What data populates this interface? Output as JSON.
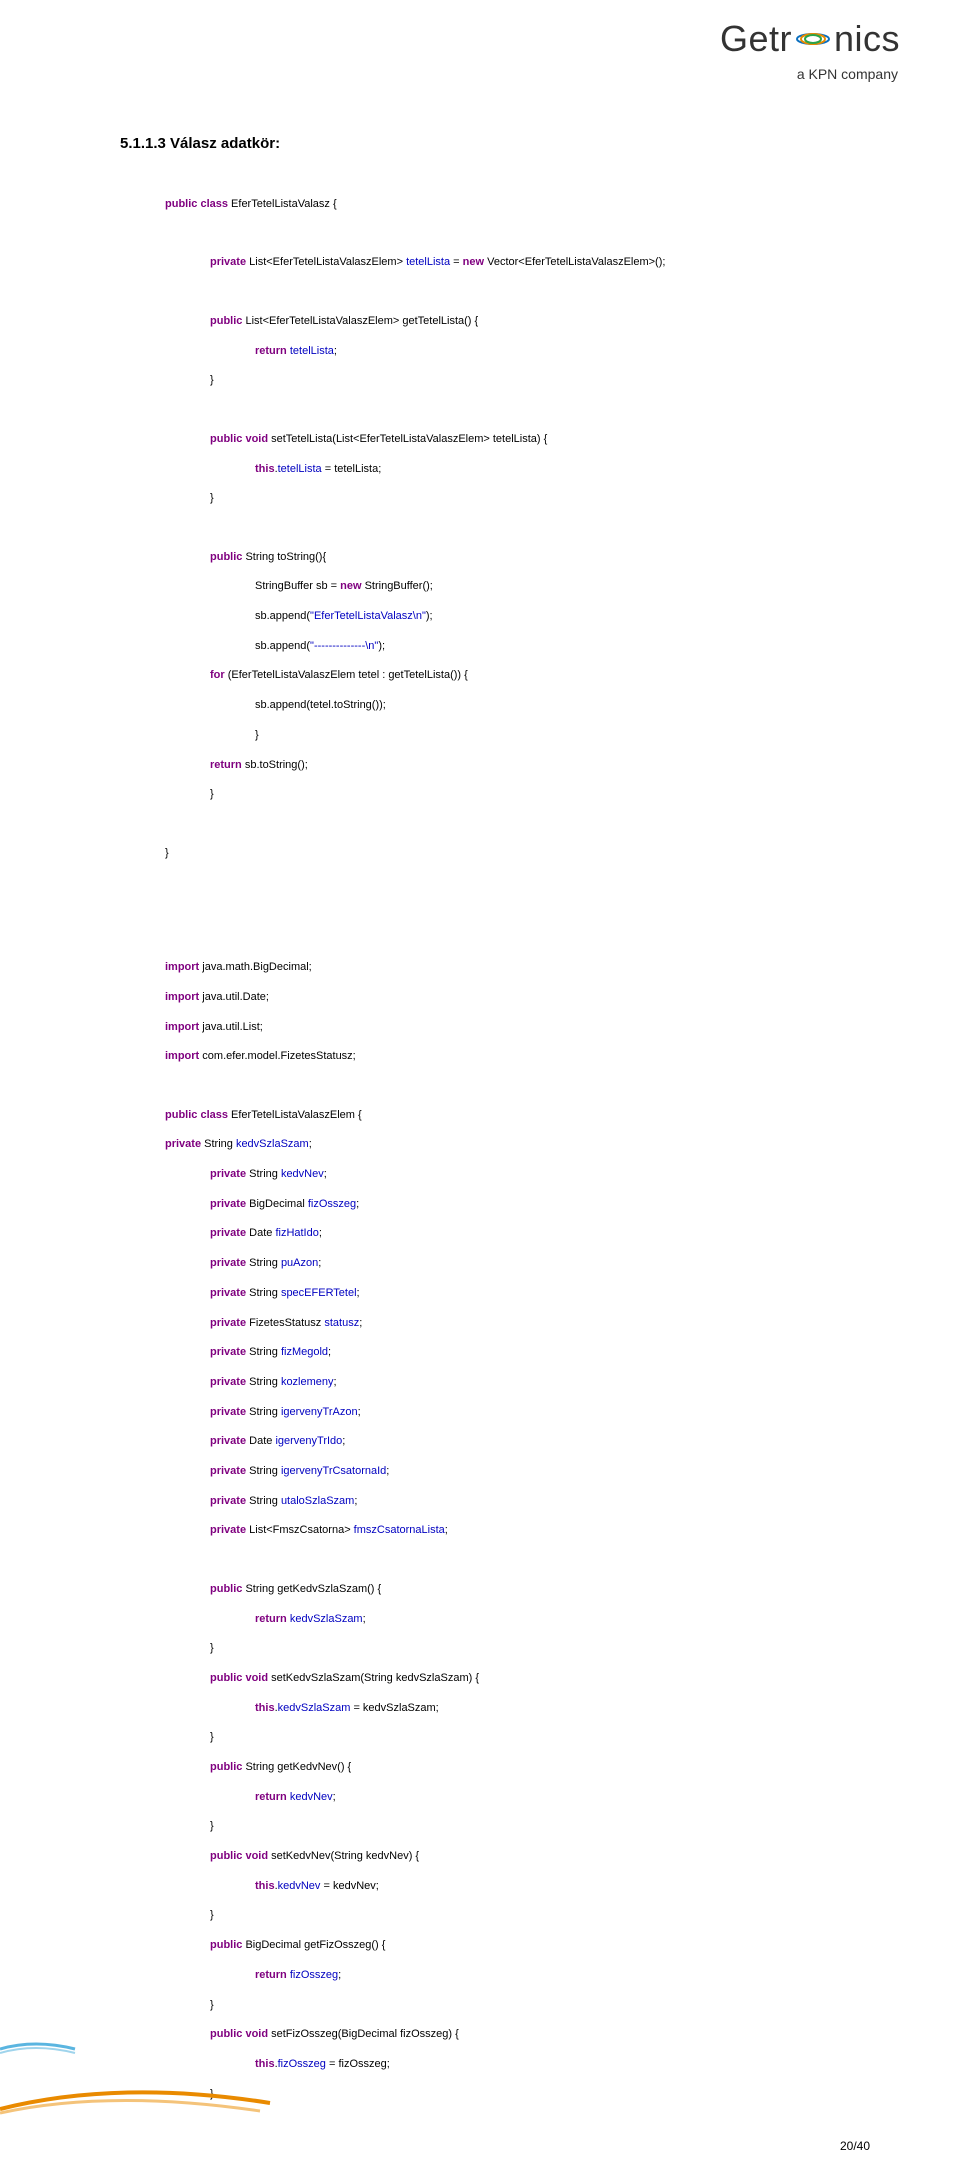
{
  "logo": {
    "text_left": "Getr",
    "text_right": "nics",
    "sub": "a KPN company"
  },
  "heading": "5.1.1.3 Válasz adatkör:",
  "code1": {
    "l1_kw1": "public",
    "l1_kw2": "class",
    "l1_cls": "EferTetelListaValasz {",
    "l2_kw": "private",
    "l2_t1": "List<EferTetelListaValaszElem> ",
    "l2_id": "tetelLista",
    "l2_t2": " = ",
    "l2_kw2": "new",
    "l2_t3": " Vector<EferTetelListaValaszElem>();",
    "l3_kw": "public",
    "l3_t": " List<EferTetelListaValaszElem> getTetelLista() {",
    "l4_kw": "return",
    "l4_id": "tetelLista",
    "l4_t": ";",
    "l5": "}",
    "l6_kw1": "public",
    "l6_kw2": "void",
    "l6_t": " setTetelLista(List<EferTetelListaValaszElem> tetelLista) {",
    "l7_kw": "this",
    "l7_t1": ".",
    "l7_id": "tetelLista",
    "l7_t2": " = tetelLista;",
    "l8": "}",
    "l9_kw": "public",
    "l9_t": " String toString(){",
    "l10_t1": "StringBuffer sb = ",
    "l10_kw": "new",
    "l10_t2": " StringBuffer();",
    "l11_t1": "sb.append(",
    "l11_str": "\"EferTetelListaValasz\\n\"",
    "l11_t2": ");",
    "l12_t1": "sb.append(",
    "l12_str": "\"--------------\\n\"",
    "l12_t2": ");",
    "l13_kw": "for",
    "l13_t": " (EferTetelListaValaszElem tetel : getTetelLista()) {",
    "l14": "sb.append(tetel.toString());",
    "l15": "}",
    "l16_kw": "return",
    "l16_t": " sb.toString();",
    "l17": "}",
    "l18": "}"
  },
  "code2": {
    "i1_kw": "import",
    "i1_t": " java.math.BigDecimal;",
    "i2_kw": "import",
    "i2_t": " java.util.Date;",
    "i3_kw": "import",
    "i3_t": " java.util.List;",
    "i4_kw": "import",
    "i4_t": " com.efer.model.FizetesStatusz;",
    "c1_kw1": "public",
    "c1_kw2": "class",
    "c1_t": " EferTetelListaValaszElem {",
    "p1_kw": "private",
    "p1_t": " String ",
    "p1_id": "kedvSzlaSzam",
    "p1_e": ";",
    "p2_kw": "private",
    "p2_t": " String ",
    "p2_id": "kedvNev",
    "p2_e": ";",
    "p3_kw": "private",
    "p3_t": " BigDecimal ",
    "p3_id": "fizOsszeg",
    "p3_e": ";",
    "p4_kw": "private",
    "p4_t": " Date ",
    "p4_id": "fizHatIdo",
    "p4_e": ";",
    "p5_kw": "private",
    "p5_t": " String ",
    "p5_id": "puAzon",
    "p5_e": ";",
    "p6_kw": "private",
    "p6_t": " String ",
    "p6_id": "specEFERTetel",
    "p6_e": ";",
    "p7_kw": "private",
    "p7_t": " FizetesStatusz ",
    "p7_id": "statusz",
    "p7_e": ";",
    "p8_kw": "private",
    "p8_t": " String ",
    "p8_id": "fizMegold",
    "p8_e": ";",
    "p9_kw": "private",
    "p9_t": " String ",
    "p9_id": "kozlemeny",
    "p9_e": ";",
    "p10_kw": "private",
    "p10_t": " String ",
    "p10_id": "igervenyTrAzon",
    "p10_e": ";",
    "p11_kw": "private",
    "p11_t": " Date ",
    "p11_id": "igervenyTrIdo",
    "p11_e": ";",
    "p12_kw": "private",
    "p12_t": " String ",
    "p12_id": "igervenyTrCsatornaId",
    "p12_e": ";",
    "p13_kw": "private",
    "p13_t": " String ",
    "p13_id": "utaloSzlaSzam",
    "p13_e": ";",
    "p14_kw": "private",
    "p14_t": " List<FmszCsatorna> ",
    "p14_id": "fmszCsatornaLista",
    "p14_e": ";",
    "m1a_kw": "public",
    "m1a_t": " String getKedvSzlaSzam() {",
    "m1b_kw": "return",
    "m1b_id": "kedvSzlaSzam",
    "m1b_e": ";",
    "m1c": "}",
    "m2a_kw1": "public",
    "m2a_kw2": "void",
    "m2a_t": " setKedvSzlaSzam(String kedvSzlaSzam) {",
    "m2b_kw": "this",
    "m2b_t1": ".",
    "m2b_id": "kedvSzlaSzam",
    "m2b_t2": " = kedvSzlaSzam;",
    "m2c": "}",
    "m3a_kw": "public",
    "m3a_t": " String getKedvNev() {",
    "m3b_kw": "return",
    "m3b_id": "kedvNev",
    "m3b_e": ";",
    "m3c": "}",
    "m4a_kw1": "public",
    "m4a_kw2": "void",
    "m4a_t": " setKedvNev(String kedvNev) {",
    "m4b_kw": "this",
    "m4b_t1": ".",
    "m4b_id": "kedvNev",
    "m4b_t2": " = kedvNev;",
    "m4c": "}",
    "m5a_kw": "public",
    "m5a_t": " BigDecimal getFizOsszeg() {",
    "m5b_kw": "return",
    "m5b_id": "fizOsszeg",
    "m5b_e": ";",
    "m5c": "}",
    "m6a_kw1": "public",
    "m6a_kw2": "void",
    "m6a_t": " setFizOsszeg(BigDecimal fizOsszeg) {",
    "m6b_kw": "this",
    "m6b_t1": ".",
    "m6b_id": "fizOsszeg",
    "m6b_t2": " = fizOsszeg;",
    "m6c": "}"
  },
  "page_number": "20/40"
}
